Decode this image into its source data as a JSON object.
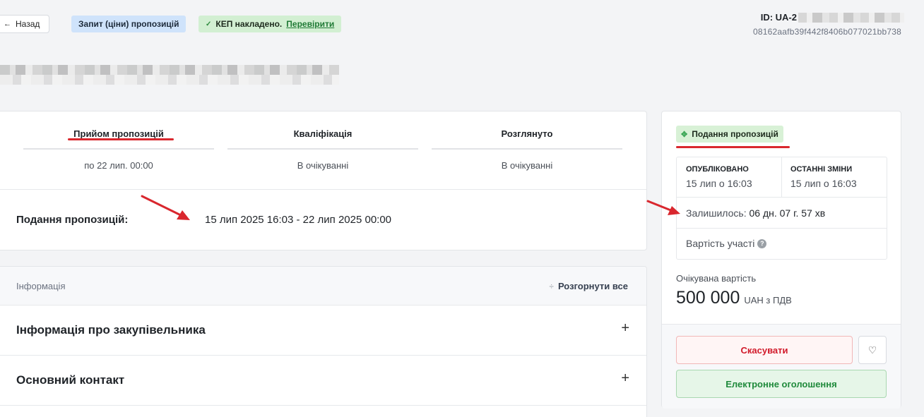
{
  "header": {
    "back_label": "Назад",
    "type_tag": "Запит (ціни) пропозицій",
    "kep_text": "КЕП накладено.",
    "kep_link": "Перевірити",
    "id_label": "ID: UA-2",
    "hash": "08162aafb39f442f8406b077021bb738"
  },
  "timeline": {
    "stages": [
      {
        "name": "Прийом пропозицій",
        "sub": "по 22 лип. 00:00"
      },
      {
        "name": "Кваліфікація",
        "sub": "В очікуванні"
      },
      {
        "name": "Розглянуто",
        "sub": "В очікуванні"
      }
    ],
    "submit_label": "Подання пропозицій:",
    "submit_value": "15 лип 2025 16:03 - 22 лип 2025 00:00"
  },
  "info": {
    "title": "Інформація",
    "expand_all": "Розгорнути все",
    "sections": [
      {
        "title": "Інформація про закупівельника"
      },
      {
        "title": "Основний контакт"
      }
    ]
  },
  "side": {
    "status": "Подання пропозицій",
    "published_label": "ОПУБЛІКОВАНО",
    "published_value": "15 лип о 16:03",
    "changed_label": "ОСТАННІ ЗМІНИ",
    "changed_value": "15 лип о 16:03",
    "remaining_label": "Залишилось:",
    "remaining_value": "06 дн. 07 г. 57 хв",
    "participation_cost": "Вартість участі",
    "expected_label": "Очікувана вартість",
    "expected_value": "500 000",
    "expected_currency": "UAH з ПДВ",
    "cancel_label": "Скасувати",
    "notice_label": "Електронне оголошення"
  },
  "colors": {
    "annotation_red": "#d9272e",
    "cancel_red": "#d11a2a",
    "notice_green": "#1f8a3b"
  }
}
